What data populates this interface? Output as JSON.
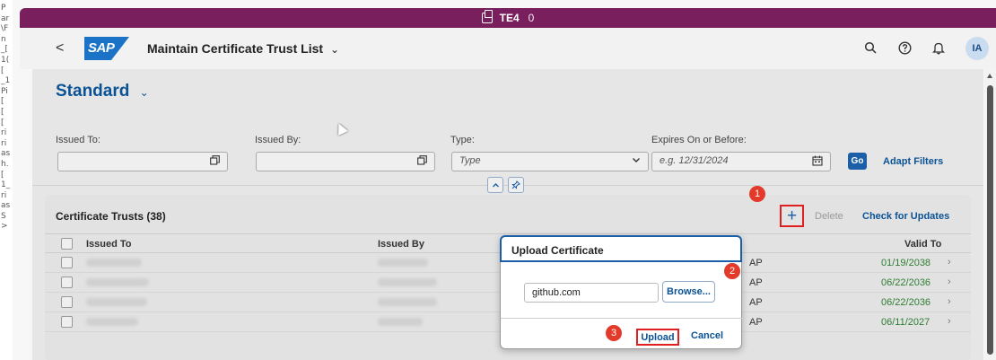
{
  "edge_strip": [
    "P",
    "ar",
    "\\F",
    "n",
    "_[",
    "1(",
    "[",
    "_1",
    "Pi",
    "[",
    "[",
    "[",
    "ri",
    "ri",
    "as",
    "h.",
    "[",
    "1_",
    "ri",
    "as",
    "S",
    ">"
  ],
  "system_bar": {
    "title": "TE4",
    "count": "0"
  },
  "shell": {
    "back_label": "<",
    "logo_text": "SAP",
    "app_title": "Maintain Certificate Trust List",
    "caret": "⌄",
    "avatar_initials": "IA"
  },
  "view": {
    "title": "Standard",
    "caret": "⌄"
  },
  "filters": {
    "issued_to": {
      "label": "Issued To:",
      "value": ""
    },
    "issued_by": {
      "label": "Issued By:",
      "value": ""
    },
    "type": {
      "label": "Type:",
      "placeholder": "Type"
    },
    "expires": {
      "label": "Expires On or Before:",
      "placeholder": "e.g. 12/31/2024"
    },
    "go_label": "Go",
    "adapt_label": "Adapt Filters"
  },
  "table": {
    "title": "Certificate Trusts (38)",
    "add_label": "+",
    "delete_label": "Delete",
    "check_label": "Check for Updates",
    "columns": {
      "issued_to": "Issued To",
      "issued_by": "Issued By",
      "valid_to": "Valid To"
    },
    "rows": [
      {
        "fragment": "AP",
        "valid_to": "01/19/2038"
      },
      {
        "fragment": "AP",
        "valid_to": "06/22/2036"
      },
      {
        "fragment": "AP",
        "valid_to": "06/22/2036"
      },
      {
        "fragment": "AP",
        "valid_to": "06/11/2027"
      }
    ]
  },
  "modal": {
    "title": "Upload Certificate",
    "file_value": "github.com",
    "browse_label": "Browse...",
    "upload_label": "Upload",
    "cancel_label": "Cancel"
  },
  "steps": {
    "one": "1",
    "two": "2",
    "three": "3"
  },
  "colors": {
    "system_bar": "#7a1f5e",
    "brand_blue": "#1a5fa8",
    "highlight_red": "#e02020",
    "step_badge": "#e33a2a",
    "date_green": "#2e7d32"
  }
}
